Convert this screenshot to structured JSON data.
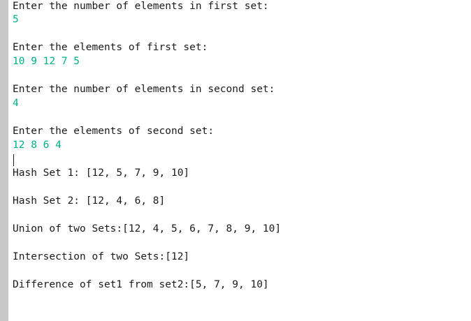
{
  "console": {
    "lines": [
      {
        "kind": "prompt",
        "text": "Enter the number of elements in first set:"
      },
      {
        "kind": "input",
        "text": "5"
      },
      {
        "kind": "prompt",
        "text": "Enter the elements of first set:"
      },
      {
        "kind": "input",
        "text": "10 9 12 7 5"
      },
      {
        "kind": "prompt",
        "text": "Enter the number of elements in second set:"
      },
      {
        "kind": "input",
        "text": "4"
      },
      {
        "kind": "prompt",
        "text": "Enter the elements of second set:"
      },
      {
        "kind": "input",
        "text": "12 8 6 4"
      },
      {
        "kind": "output",
        "text": "Hash Set 1: [12, 5, 7, 9, 10]"
      },
      {
        "kind": "output",
        "text": "Hash Set 2: [12, 4, 6, 8]"
      },
      {
        "kind": "output",
        "text": "Union of two Sets:[12, 4, 5, 6, 7, 8, 9, 10]"
      },
      {
        "kind": "output",
        "text": "Intersection of two Sets:[12]"
      },
      {
        "kind": "output",
        "text": "Difference of set1 from set2:[5, 7, 9, 10]"
      }
    ]
  },
  "colors": {
    "input_text": "#00b08a",
    "output_text": "#1a1a1a",
    "gutter": "#c8c8c8"
  }
}
